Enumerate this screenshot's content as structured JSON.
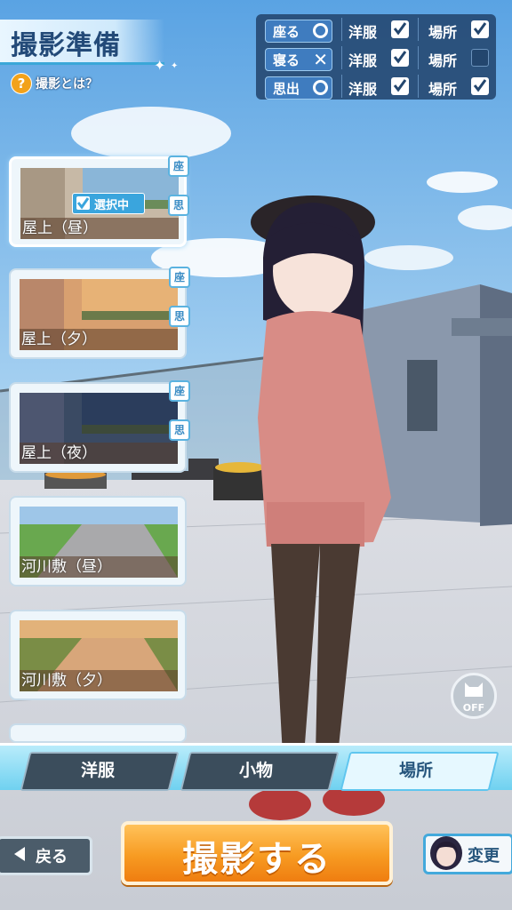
{
  "title": "撮影準備",
  "help_label": "撮影とは？",
  "help_icon": "question-icon",
  "status_rows": [
    {
      "action": "座る",
      "action_state": "circle",
      "clothes_label": "洋服",
      "clothes_checked": true,
      "place_label": "場所",
      "place_checked": true
    },
    {
      "action": "寝る",
      "action_state": "cross",
      "clothes_label": "洋服",
      "clothes_checked": true,
      "place_label": "場所",
      "place_checked": false
    },
    {
      "action": "思出",
      "action_state": "circle",
      "clothes_label": "洋服",
      "clothes_checked": true,
      "place_label": "場所",
      "place_checked": true
    }
  ],
  "locations": [
    {
      "label": "屋上（昼）",
      "tags": [
        "座",
        "思"
      ],
      "selected": true
    },
    {
      "label": "屋上（夕）",
      "tags": [
        "座",
        "思"
      ],
      "selected": false
    },
    {
      "label": "屋上（夜）",
      "tags": [
        "座",
        "思"
      ],
      "selected": false
    },
    {
      "label": "河川敷（昼）",
      "tags": [],
      "selected": false
    },
    {
      "label": "河川敷（夕）",
      "tags": [],
      "selected": false
    }
  ],
  "selected_badge": "選択中",
  "cat_toggle": {
    "icon": "cat-icon",
    "label": "OFF"
  },
  "tabs": [
    {
      "label": "洋服",
      "active": false
    },
    {
      "label": "小物",
      "active": false
    },
    {
      "label": "場所",
      "active": true
    }
  ],
  "buttons": {
    "back": "戻る",
    "shoot": "撮影する",
    "change": "変更"
  }
}
